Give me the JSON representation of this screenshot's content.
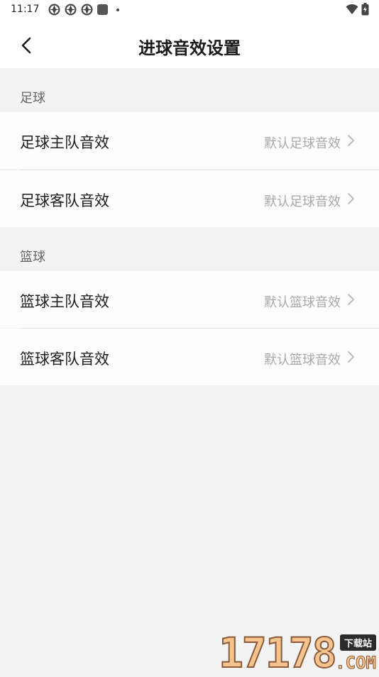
{
  "status_bar": {
    "time": "11:17",
    "left_icons": [
      "app-icon",
      "app-icon",
      "app-icon",
      "square-icon",
      "dot-icon"
    ],
    "right_icons": [
      "wifi-icon",
      "battery-icon"
    ]
  },
  "header": {
    "title": "进球音效设置",
    "back_icon": "chevron-left-icon"
  },
  "sections": [
    {
      "label": "足球",
      "rows": [
        {
          "label": "足球主队音效",
          "value": "默认足球音效"
        },
        {
          "label": "足球客队音效",
          "value": "默认足球音效"
        }
      ]
    },
    {
      "label": "篮球",
      "rows": [
        {
          "label": "篮球主队音效",
          "value": "默认篮球音效"
        },
        {
          "label": "篮球客队音效",
          "value": "默认篮球音效"
        }
      ]
    }
  ],
  "watermark": {
    "number": "17178",
    "badge": "下载站",
    "suffix": ".COM"
  },
  "colors": {
    "background": "#f3f3f3",
    "row_background": "#fdfdfd",
    "value_text": "#a8a8a8",
    "section_text": "#666666"
  }
}
